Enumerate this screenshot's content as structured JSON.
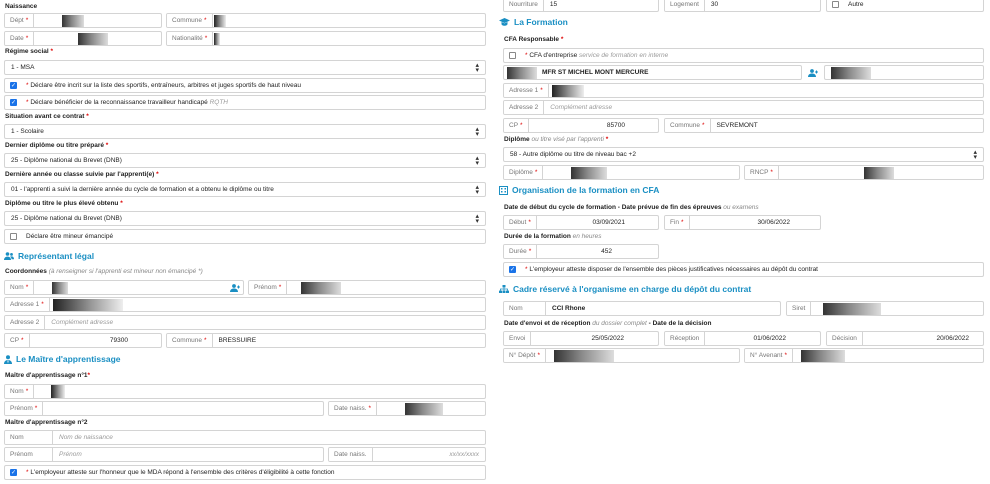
{
  "left": {
    "naissance_title": "Naissance",
    "dept_label": "Dépt",
    "commune_label": "Commune",
    "date_label": "Date",
    "nationalite_label": "Nationalité",
    "regime_label": "Régime social",
    "regime_value": "1 - MSA",
    "sportif_text": "Déclare être incrit sur la liste des sportifs, entraîneurs, arbitres et juges sportifs de haut niveau",
    "handicap_text": "Déclare bénéficier de la reconnaissance travailleur handicapé",
    "handicap_hint": "RQTH",
    "situation_label": "Situation avant ce contrat",
    "situation_value": "1 - Scolaire",
    "dernier_diplome_label": "Dernier diplôme ou titre préparé",
    "dernier_diplome_value": "25 - Diplôme national du Brevet (DNB)",
    "derniere_annee_label": "Dernière année ou classe suivie par l'apprenti(e)",
    "derniere_annee_value": "01 - l'apprenti a suivi la dernière année du cycle de formation et a obtenu le diplôme ou titre",
    "plus_eleve_label": "Diplôme ou titre le plus élevé obtenu",
    "plus_eleve_value": "25 - Diplôme national du Brevet (DNB)",
    "mineur_text": "Déclare être mineur émancipé",
    "rep_title": "Représentant légal",
    "coord_label": "Coordonnées",
    "coord_hint": "(à renseigner si l'apprenti est mineur non émancipé *)",
    "nom_label": "Nom",
    "prenom_label": "Prénom",
    "adr1_label": "Adresse 1",
    "adr2_label": "Adresse 2",
    "adr2_placeholder": "Complément adresse",
    "cp_label": "CP",
    "cp_value": "79300",
    "commune2_label": "Commune",
    "commune2_value": "BRESSUIRE",
    "maitre_title": "Le Maître d'apprentissage",
    "maitre1_label": "Maître d'apprentissage n°1",
    "m1_nom_label": "Nom",
    "m1_prenom_label": "Prénom",
    "m1_datenaiss_label": "Date naiss.",
    "maitre2_label": "Maître d'apprentissage n°2",
    "m2_nom_label": "Nom",
    "m2_nom_placeholder": "Nom de naissance",
    "m2_prenom_label": "Prénom",
    "m2_prenom_placeholder": "Prénom",
    "m2_datenaiss_label": "Date naiss.",
    "m2_datenaiss_placeholder": "xx/xx/xxxx",
    "mda_text": "L'employeur atteste sur l'honneur que le MDA répond à l'ensemble des critères d'éligibilité à cette fonction"
  },
  "right": {
    "nourriture_label": "Nourriture",
    "nourriture_value": "15",
    "logement_label": "Logement",
    "logement_value": "30",
    "autre_label": "Autre",
    "formation_title": "La Formation",
    "cfa_resp_label": "CFA Responsable",
    "cfa_entreprise_text": "CFA d'entreprise",
    "cfa_entreprise_hint": "service de formation en interne",
    "cfa_name": "MFR ST MICHEL MONT MERCURE",
    "adr1_label": "Adresse 1",
    "adr2_label": "Adresse 2",
    "adr2_placeholder": "Complément adresse",
    "cp_label": "CP",
    "cp_value": "85700",
    "commune_label": "Commune",
    "commune_value": "SEVREMONT",
    "diplome_label": "Diplôme",
    "diplome_hint": "ou titre visé par l'apprenti",
    "diplome_value": "58 - Autre diplôme ou titre de niveau bac +2",
    "diplome_field_label": "Diplôme",
    "rncp_label": "RNCP",
    "orga_title": "Organisation de la formation en CFA",
    "dates_label": "Date de début du cycle de formation - Date prévue de fin des épreuves",
    "dates_hint": "ou examens",
    "debut_label": "Début",
    "debut_value": "03/09/2021",
    "fin_label": "Fin",
    "fin_value": "30/06/2022",
    "duree_title": "Durée de la formation",
    "duree_hint": "en heures",
    "duree_label": "Durée",
    "duree_value": "452",
    "pieces_text": "L'employeur atteste disposer de l'ensemble des pièces justificatives nécessaires au dépôt du contrat",
    "cadre_title": "Cadre réservé à l'organisme en charge du dépôt du contrat",
    "org_nom_label": "Nom",
    "org_nom_value": "CCI Rhone",
    "siret_label": "Siret",
    "envoi_title": "Date d'envoi et de réception",
    "envoi_hint": "du dossier complet",
    "decision_title": "- Date de la décision",
    "envoi_label": "Envoi",
    "envoi_value": "25/05/2022",
    "reception_label": "Réception",
    "reception_value": "01/06/2022",
    "decision_label": "Décision",
    "decision_value": "20/06/2022",
    "ndepot_label": "N° Dépôt",
    "navenant_label": "N° Avenant"
  },
  "colors": {
    "accent": "#1a8fc3",
    "required": "#d00",
    "checkbox": "#1a73e8"
  },
  "icons": [
    "users-icon",
    "user-tie-icon",
    "graduation-cap-icon",
    "building-icon",
    "sitemap-icon",
    "user-add-icon"
  ]
}
